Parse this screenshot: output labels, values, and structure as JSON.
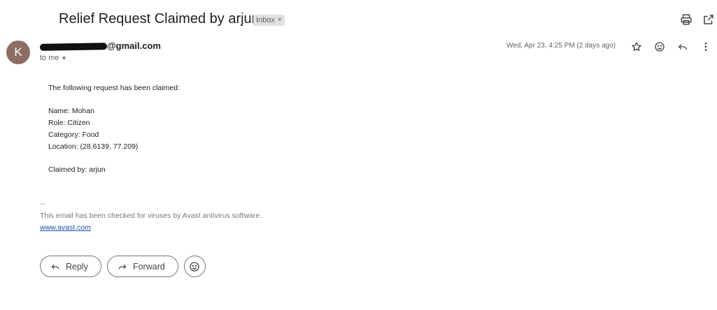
{
  "email": {
    "subject": "Relief Request Claimed by arjun",
    "label": "Inbox",
    "label_close": "×",
    "sender_initial": "K",
    "sender_visible": "@gmail.com",
    "to_line": "to me",
    "date": "Wed, Apr 23, 4:25 PM (2 days ago)"
  },
  "body": {
    "intro": "The following request has been claimed:",
    "name": "Name: Mohan",
    "role": "Role: Citizen",
    "category": "Category: Food",
    "location": "Location: (28.6139, 77.209)",
    "claimed_by": "Claimed by: arjun"
  },
  "signature": {
    "dashes": "--",
    "text": "This email has been checked for viruses by Avast antivirus software.",
    "link": "www.avast.com"
  },
  "actions": {
    "reply": "Reply",
    "forward": "Forward"
  },
  "icons": {
    "print": "print-icon",
    "open_new": "open-in-new-icon",
    "star": "star-icon",
    "emoji": "emoji-icon",
    "reply": "reply-icon",
    "more": "more-vert-icon",
    "forward": "forward-icon"
  }
}
